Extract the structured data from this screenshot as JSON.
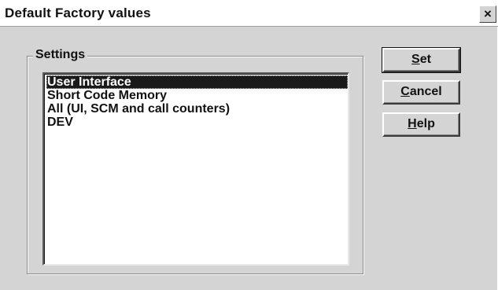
{
  "window": {
    "title": "Default Factory values",
    "close_glyph": "×",
    "close_icon": "close-icon"
  },
  "settings": {
    "group_label": "Settings",
    "items": [
      {
        "label": "User Interface",
        "selected": true
      },
      {
        "label": "Short Code Memory",
        "selected": false
      },
      {
        "label": "All (UI, SCM and call counters)",
        "selected": false
      },
      {
        "label": "DEV",
        "selected": false
      }
    ]
  },
  "buttons": {
    "set": {
      "mnemonic": "S",
      "rest": "et"
    },
    "cancel": {
      "mnemonic": "C",
      "rest": "ancel"
    },
    "help": {
      "mnemonic": "H",
      "rest": "elp"
    }
  },
  "colors": {
    "dialog_bg": "#d4d4d4",
    "selection_bg": "#1a1a1a",
    "selection_text": "#ffffff"
  }
}
